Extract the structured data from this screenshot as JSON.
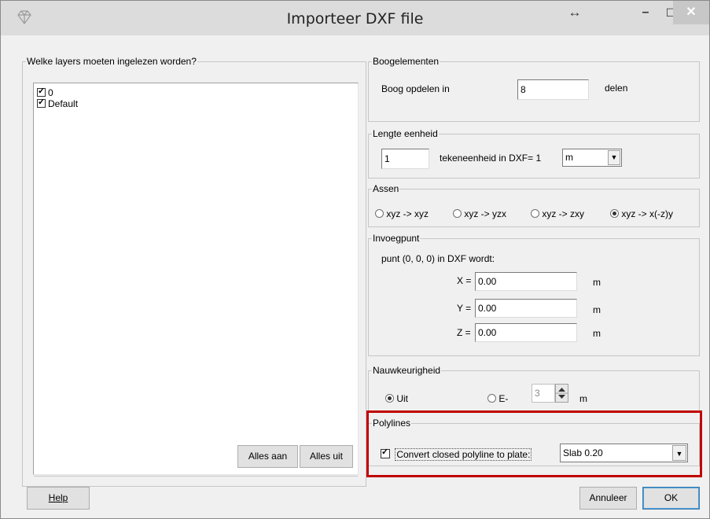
{
  "window": {
    "title": "Importeer DXF file",
    "titlebar_buttons": {
      "resize": "↔",
      "minimize": "–",
      "maximize": "☐",
      "close": "✕"
    }
  },
  "layers": {
    "legend": "Welke layers moeten ingelezen worden?",
    "items": [
      {
        "label": "0",
        "checked": true
      },
      {
        "label": "Default",
        "checked": true
      }
    ],
    "btn_all_on": "Alles aan",
    "btn_all_off": "Alles uit"
  },
  "arc": {
    "legend": "Boogelementen",
    "label": "Boog opdelen in",
    "value": "8",
    "unit": "delen"
  },
  "length_unit": {
    "legend": "Lengte eenheid",
    "value": "1",
    "label": "tekeneenheid in DXF=",
    "factor": "1",
    "unit_selected": "m"
  },
  "axes": {
    "legend": "Assen",
    "options": [
      {
        "label": "xyz -> xyz",
        "selected": false
      },
      {
        "label": "xyz -> yzx",
        "selected": false
      },
      {
        "label": "xyz -> zxy",
        "selected": false
      },
      {
        "label": "xyz -> x(-z)y",
        "selected": true
      }
    ]
  },
  "insert_point": {
    "legend": "Invoegpunt",
    "description": "punt (0, 0, 0) in DXF wordt:",
    "x_label": "X =",
    "x_value": "0.00",
    "y_label": "Y =",
    "y_value": "0.00",
    "z_label": "Z =",
    "z_value": "0.00",
    "unit": "m"
  },
  "precision": {
    "legend": "Nauwkeurigheid",
    "option_off": "Uit",
    "option_off_selected": true,
    "option_e": "E-",
    "option_e_selected": false,
    "e_value": "3",
    "unit": "m"
  },
  "polylines": {
    "legend": "Polylines",
    "checkbox_label": "Convert closed polyline to plate:",
    "checked": true,
    "plate_selected": "Slab 0.20"
  },
  "footer": {
    "help_label": "Help",
    "cancel_label": "Annuleer",
    "ok_label": "OK"
  },
  "colors": {
    "highlight": "#c00000",
    "titlebar": "#dcdcdc",
    "dialog_bg": "#f0f0f0"
  }
}
